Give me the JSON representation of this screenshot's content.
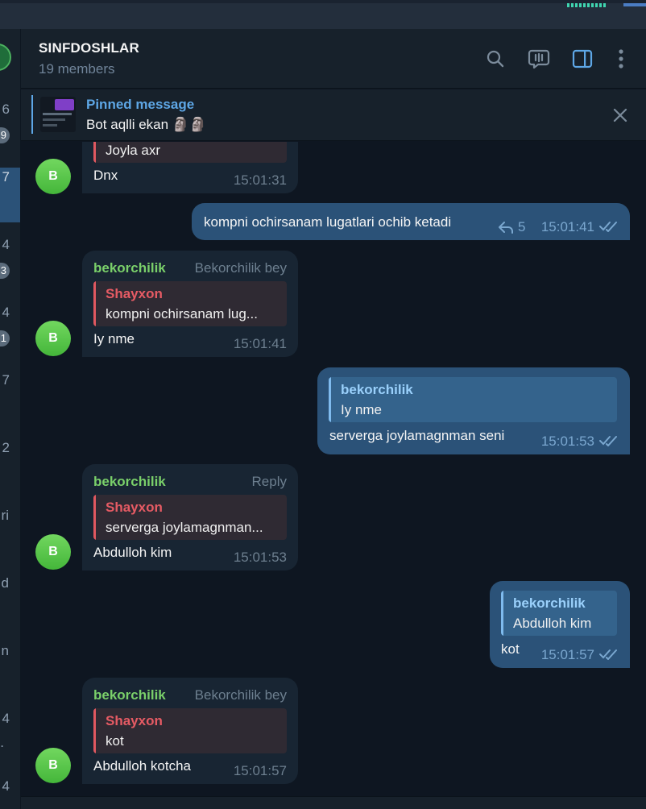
{
  "chat_list_fragments": {
    "numbers": [
      "6",
      "7",
      "4",
      "4",
      "7",
      "2",
      "ri",
      "d",
      "n",
      "4",
      ".",
      "4"
    ],
    "badges": [
      "9",
      "3",
      "1"
    ]
  },
  "header": {
    "title": "SINFDOSHLAR",
    "subtitle": "19 members"
  },
  "pinned": {
    "title": "Pinned message",
    "text": "Bot aqlli ekan 🗿🗿"
  },
  "messages": [
    {
      "dir": "in",
      "avatar": "B",
      "reply_text": "Joyla axr",
      "text": "Dnx",
      "time": "15:01:31"
    },
    {
      "dir": "out",
      "text": "kompni ochirsanam lugatlari ochib ketadi",
      "replies": "5",
      "time": "15:01:41"
    },
    {
      "dir": "in",
      "avatar": "B",
      "sender": "bekorchilik",
      "sender_tag": "Bekorchilik bey",
      "reply_name": "Shayxon",
      "reply_text": "kompni ochirsanam lug...",
      "text": "Iy nme",
      "time": "15:01:41"
    },
    {
      "dir": "out",
      "reply_name": "bekorchilik",
      "reply_text": "Iy nme",
      "text": "serverga joylamagnman seni",
      "time": "15:01:53"
    },
    {
      "dir": "in",
      "avatar": "B",
      "sender": "bekorchilik",
      "sender_tag": "Reply",
      "reply_name": "Shayxon",
      "reply_text": "serverga joylamagnman...",
      "text": "Abdulloh kim",
      "time": "15:01:53"
    },
    {
      "dir": "out",
      "reply_name": "bekorchilik",
      "reply_text": "Abdulloh kim",
      "text": "kot",
      "time": "15:01:57"
    },
    {
      "dir": "in",
      "avatar": "B",
      "sender": "bekorchilik",
      "sender_tag": "Bekorchilik bey",
      "reply_name": "Shayxon",
      "reply_text": "kot",
      "text": "Abdulloh kotcha",
      "time": "15:01:57"
    }
  ],
  "colors": {
    "background": "#0e1621",
    "panel": "#17212b",
    "bubble_in": "#182533",
    "bubble_out": "#2b5278",
    "accent": "#5ea7e6",
    "sender_name": "#7ad06a",
    "reply_name_in": "#e65b64"
  },
  "icons": [
    "search-icon",
    "video-chat-icon",
    "sidebar-toggle-icon",
    "more-vertical-icon",
    "close-icon",
    "reply-arrow-icon",
    "double-check-icon"
  ]
}
